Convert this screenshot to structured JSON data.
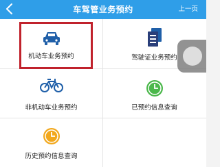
{
  "header": {
    "title": "车驾管业务预约",
    "prev_label": "上一页"
  },
  "colors": {
    "topbar": "#2f9ee8",
    "icon_blue": "#1f5fa8",
    "icon_green": "#4bb84b",
    "icon_orange": "#f2a81d",
    "highlight_border": "#c0222c"
  },
  "menu": [
    {
      "label": "机动车业务预约",
      "icon": "car-icon"
    },
    {
      "label": "驾驶证业务预约",
      "icon": "license-document-icon"
    },
    {
      "label": "非机动车业务预约",
      "icon": "bicycle-icon"
    },
    {
      "label": "已预约信息查询",
      "icon": "clock-icon"
    },
    {
      "label": "历史预约信息查询",
      "icon": "clock-icon"
    }
  ]
}
